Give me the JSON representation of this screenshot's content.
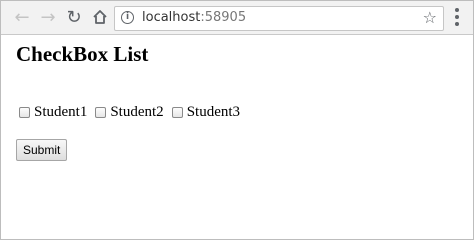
{
  "browser": {
    "url_host": "localhost",
    "url_port": ":58905",
    "back_icon": "arrow-left-icon",
    "forward_icon": "arrow-right-icon",
    "reload_icon": "reload-icon",
    "home_icon": "home-icon",
    "info_icon": "info-icon",
    "bookmark_icon": "star-icon",
    "menu_icon": "kebab-menu-icon"
  },
  "page": {
    "title": "CheckBox List",
    "checkboxes": [
      {
        "label": "Student1",
        "checked": false
      },
      {
        "label": "Student2",
        "checked": false
      },
      {
        "label": "Student3",
        "checked": false
      }
    ],
    "submit_label": "Submit"
  }
}
